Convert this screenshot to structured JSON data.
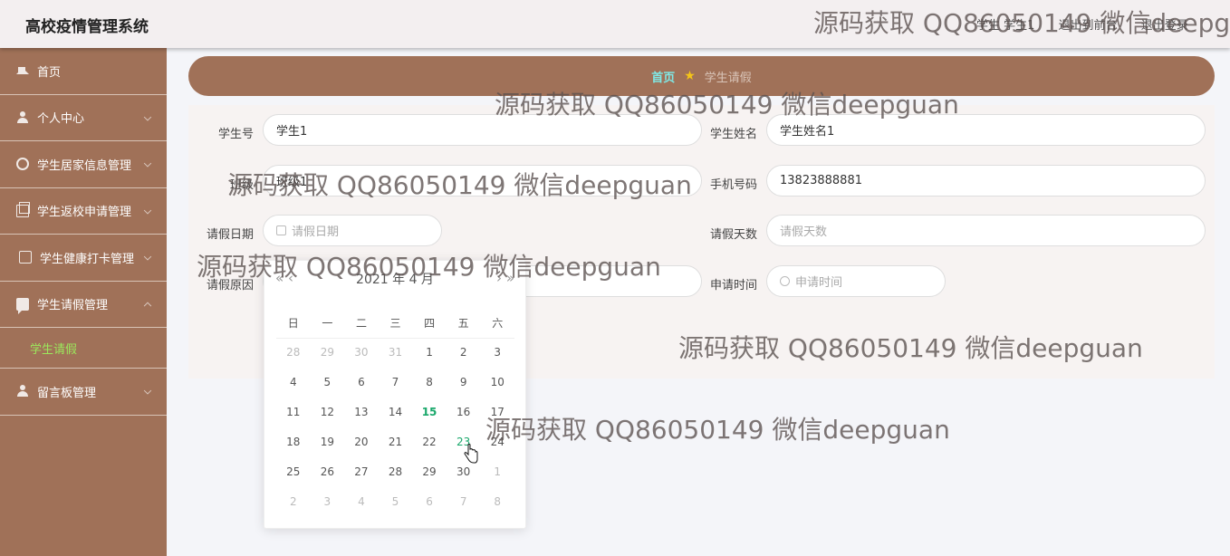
{
  "header": {
    "app_title": "高校疫情管理系统",
    "user_label": "学生 学生1",
    "front_link": "退出到前台",
    "logout": "退出登录"
  },
  "sidebar": {
    "items": [
      {
        "label": "首页",
        "icon": "home-icon"
      },
      {
        "label": "个人中心",
        "icon": "user-icon"
      },
      {
        "label": "学生居家信息管理",
        "icon": "ring-icon"
      },
      {
        "label": "学生返校申请管理",
        "icon": "document-icon"
      },
      {
        "label": "学生健康打卡管理",
        "icon": "phone-icon"
      },
      {
        "label": "学生请假管理",
        "icon": "chat-icon"
      },
      {
        "label": "留言板管理",
        "icon": "user-icon"
      }
    ],
    "active_sub": "学生请假"
  },
  "breadcrumb": {
    "home": "首页",
    "separator": "★",
    "current": "学生请假"
  },
  "form": {
    "student_no": {
      "label": "学生号",
      "value": "学生1"
    },
    "student_name": {
      "label": "学生姓名",
      "value": "学生姓名1"
    },
    "class_field": {
      "label": "班级",
      "value": "班级1"
    },
    "phone": {
      "label": "手机号码",
      "value": "13823888881"
    },
    "leave_date": {
      "label": "请假日期",
      "placeholder": "请假日期"
    },
    "leave_days": {
      "label": "请假天数",
      "placeholder": "请假天数"
    },
    "leave_reason": {
      "label": "请假原因",
      "placeholder": ""
    },
    "apply_time": {
      "label": "申请时间",
      "placeholder": "申请时间"
    }
  },
  "datepicker": {
    "prev": "« ‹",
    "next": "› »",
    "title": "2021 年  4 月",
    "weekdays": [
      "日",
      "一",
      "二",
      "三",
      "四",
      "五",
      "六"
    ],
    "days": [
      {
        "d": "28",
        "m": true
      },
      {
        "d": "29",
        "m": true
      },
      {
        "d": "30",
        "m": true
      },
      {
        "d": "31",
        "m": true
      },
      {
        "d": "1"
      },
      {
        "d": "2"
      },
      {
        "d": "3"
      },
      {
        "d": "4"
      },
      {
        "d": "5"
      },
      {
        "d": "6"
      },
      {
        "d": "7"
      },
      {
        "d": "8"
      },
      {
        "d": "9"
      },
      {
        "d": "10"
      },
      {
        "d": "11"
      },
      {
        "d": "12"
      },
      {
        "d": "13"
      },
      {
        "d": "14"
      },
      {
        "d": "15",
        "today": true
      },
      {
        "d": "16"
      },
      {
        "d": "17"
      },
      {
        "d": "18"
      },
      {
        "d": "19"
      },
      {
        "d": "20"
      },
      {
        "d": "21"
      },
      {
        "d": "22"
      },
      {
        "d": "23",
        "hover": true
      },
      {
        "d": "24"
      },
      {
        "d": "25"
      },
      {
        "d": "26"
      },
      {
        "d": "27"
      },
      {
        "d": "28"
      },
      {
        "d": "29"
      },
      {
        "d": "30"
      },
      {
        "d": "1",
        "m": true
      },
      {
        "d": "2",
        "m": true
      },
      {
        "d": "3",
        "m": true
      },
      {
        "d": "4",
        "m": true
      },
      {
        "d": "5",
        "m": true
      },
      {
        "d": "6",
        "m": true
      },
      {
        "d": "7",
        "m": true
      },
      {
        "d": "8",
        "m": true
      }
    ]
  },
  "watermark": "源码获取 QQ86050149 微信deepguan",
  "colors": {
    "sidebar": "#a07158",
    "accent_green": "#9be85c",
    "today": "#1aa86b"
  }
}
